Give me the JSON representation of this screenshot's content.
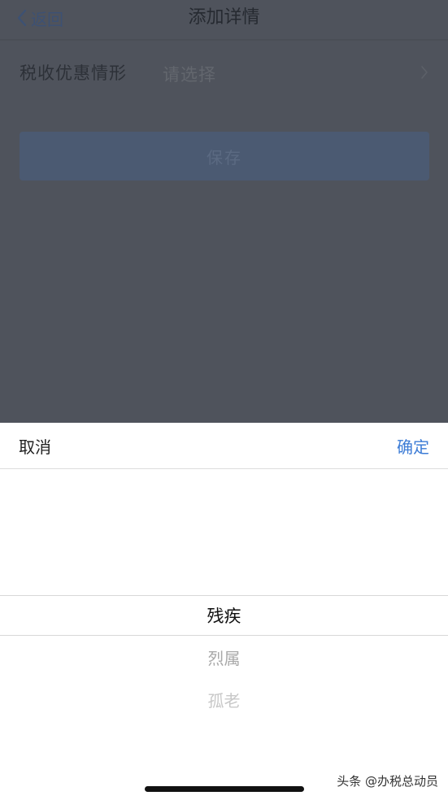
{
  "navbar": {
    "back_label": "返回",
    "title": "添加详情"
  },
  "form": {
    "tax_preference": {
      "label": "税收优惠情形",
      "placeholder": "请选择"
    },
    "save_label": "保存"
  },
  "picker": {
    "cancel_label": "取消",
    "confirm_label": "确定",
    "options": [
      "残疾",
      "烈属",
      "孤老"
    ],
    "selected": "残疾"
  },
  "watermark": "头条 @办税总动员",
  "colors": {
    "accent": "#3d7cd6",
    "overlay": "#4f535c"
  }
}
